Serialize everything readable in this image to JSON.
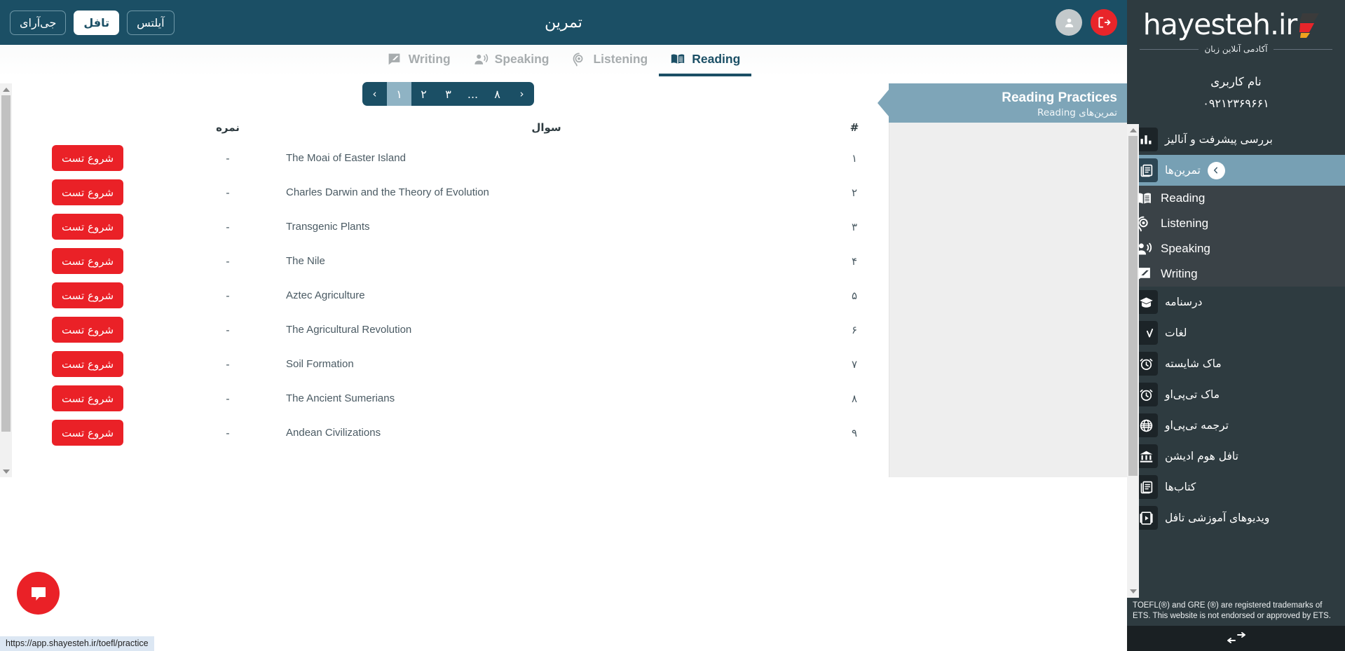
{
  "topbar": {
    "title": "تمرین",
    "logout_icon": "logout-icon",
    "user_icon": "user-avatar-icon",
    "exams": [
      {
        "label": "جی‌آر‌ای",
        "selected": false
      },
      {
        "label": "تافل",
        "selected": true
      },
      {
        "label": "آیلتس",
        "selected": false
      }
    ]
  },
  "tabs": [
    {
      "label": "Writing",
      "icon": "writing-icon",
      "active": false
    },
    {
      "label": "Speaking",
      "icon": "speaking-icon",
      "active": false
    },
    {
      "label": "Listening",
      "icon": "listening-icon",
      "active": false
    },
    {
      "label": "Reading",
      "icon": "reading-icon",
      "active": true
    }
  ],
  "practice_panel": {
    "title": "Reading Practices",
    "subtitle": "تمرین‌های Reading"
  },
  "pagination": {
    "prev": "‹",
    "next": "›",
    "pages": [
      "۱",
      "۲",
      "۳",
      "...",
      "۸"
    ],
    "current": "۱"
  },
  "table": {
    "headers": {
      "num": "#",
      "question": "سوال",
      "score": "نمره",
      "action": ""
    },
    "rows": [
      {
        "num": "۱",
        "question": "The Moai of Easter Island",
        "score": "-",
        "action": "شروع تست"
      },
      {
        "num": "۲",
        "question": "Charles Darwin and the Theory of Evolution",
        "score": "-",
        "action": "شروع تست"
      },
      {
        "num": "۳",
        "question": "Transgenic Plants",
        "score": "-",
        "action": "شروع تست"
      },
      {
        "num": "۴",
        "question": "The Nile",
        "score": "-",
        "action": "شروع تست"
      },
      {
        "num": "۵",
        "question": "Aztec Agriculture",
        "score": "-",
        "action": "شروع تست"
      },
      {
        "num": "۶",
        "question": "The Agricultural Revolution",
        "score": "-",
        "action": "شروع تست"
      },
      {
        "num": "۷",
        "question": "Soil Formation",
        "score": "-",
        "action": "شروع تست"
      },
      {
        "num": "۸",
        "question": "The Ancient Sumerians",
        "score": "-",
        "action": "شروع تست"
      },
      {
        "num": "۹",
        "question": "Andean Civilizations",
        "score": "-",
        "action": "شروع تست"
      }
    ]
  },
  "sidebar": {
    "brand_word": "hayesteh.ir",
    "brand_sub": "آکادمی آنلاین زبان",
    "user_name": "نام کاربری",
    "user_phone": "۰۹۲۱۲۳۶۹۶۶۱",
    "items": [
      {
        "label": "بررسی پیشرفت و آنالیز",
        "icon": "bar-chart-icon",
        "active": false
      },
      {
        "label": "تمرین‌ها",
        "icon": "exercises-icon",
        "active": true
      },
      {
        "label": "درسنامه",
        "icon": "graduation-cap-icon",
        "active": false
      },
      {
        "label": "لغات",
        "icon": "vocabulary-icon",
        "active": false
      },
      {
        "label": "ماک شایسته",
        "icon": "alarm-clock-icon",
        "active": false
      },
      {
        "label": "ماک تی‌پی‌او",
        "icon": "alarm-clock-icon",
        "active": false
      },
      {
        "label": "ترجمه تی‌پی‌او",
        "icon": "globe-icon",
        "active": false
      },
      {
        "label": "تافل هوم ادیشن",
        "icon": "bank-icon",
        "active": false
      },
      {
        "label": "کتاب‌ها",
        "icon": "books-icon",
        "active": false
      },
      {
        "label": "ویدیوهای آموزشی تافل",
        "icon": "video-icon",
        "active": false
      }
    ],
    "subitems": [
      {
        "label": "Reading",
        "icon": "reading-icon"
      },
      {
        "label": "Listening",
        "icon": "listening-icon"
      },
      {
        "label": "Speaking",
        "icon": "speaking-icon"
      },
      {
        "label": "Writing",
        "icon": "writing-icon"
      }
    ],
    "footer_note": "TOEFL(®) and GRE (®) are registered trademarks of ETS. This website is not endorsed or approved by ETS.",
    "collapse_icon": "collapse-arrows-icon"
  },
  "chat": {
    "icon": "chat-bubble-icon"
  },
  "status_url": "https://app.shayesteh.ir/toefl/practice",
  "colors": {
    "accent_dark": "#1b4f65",
    "sidebar_bg": "#2e3b40",
    "red": "#ea2127",
    "panel_head": "#7ea5b8"
  }
}
